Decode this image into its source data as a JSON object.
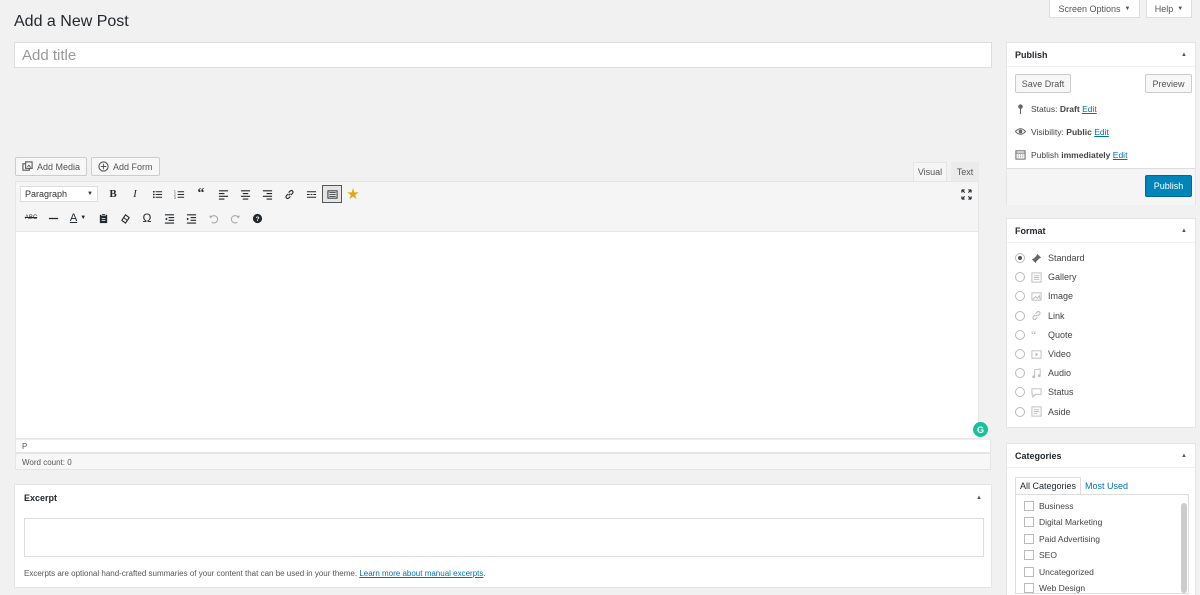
{
  "page": {
    "title": "Add a New Post"
  },
  "top_tabs": {
    "screen_options": "Screen Options",
    "help": "Help"
  },
  "title_field": {
    "placeholder": "Add title",
    "value": ""
  },
  "media_buttons": {
    "add_media": "Add Media",
    "add_form": "Add Form"
  },
  "editor_tabs": {
    "visual": "Visual",
    "text": "Text",
    "active": "Visual"
  },
  "toolbar": {
    "paragraph_select": "Paragraph"
  },
  "editor": {
    "path": "P",
    "word_count": "Word count: 0"
  },
  "excerpt": {
    "heading": "Excerpt",
    "help_text": "Excerpts are optional hand-crafted summaries of your content that can be used in your theme.",
    "help_link": "Learn more about manual excerpts",
    "help_end": "."
  },
  "publish": {
    "heading": "Publish",
    "save_draft": "Save Draft",
    "preview": "Preview",
    "status_label": "Status:",
    "status_value": "Draft",
    "visibility_label": "Visibility:",
    "visibility_value": "Public",
    "schedule_label": "Publish",
    "schedule_value": "immediately",
    "edit": "Edit",
    "publish_button": "Publish"
  },
  "format": {
    "heading": "Format",
    "selected": "Standard",
    "options": [
      "Standard",
      "Gallery",
      "Image",
      "Link",
      "Quote",
      "Video",
      "Audio",
      "Status",
      "Aside"
    ]
  },
  "categories": {
    "heading": "Categories",
    "tab_all": "All Categories",
    "tab_most_used": "Most Used",
    "items": [
      "Business",
      "Digital Marketing",
      "Paid Advertising",
      "SEO",
      "Uncategorized",
      "Web Design"
    ]
  },
  "colors": {
    "accent": "#0073aa",
    "primary_button": "#0085ba",
    "grammarly": "#15c39a",
    "star": "#e4a812"
  }
}
